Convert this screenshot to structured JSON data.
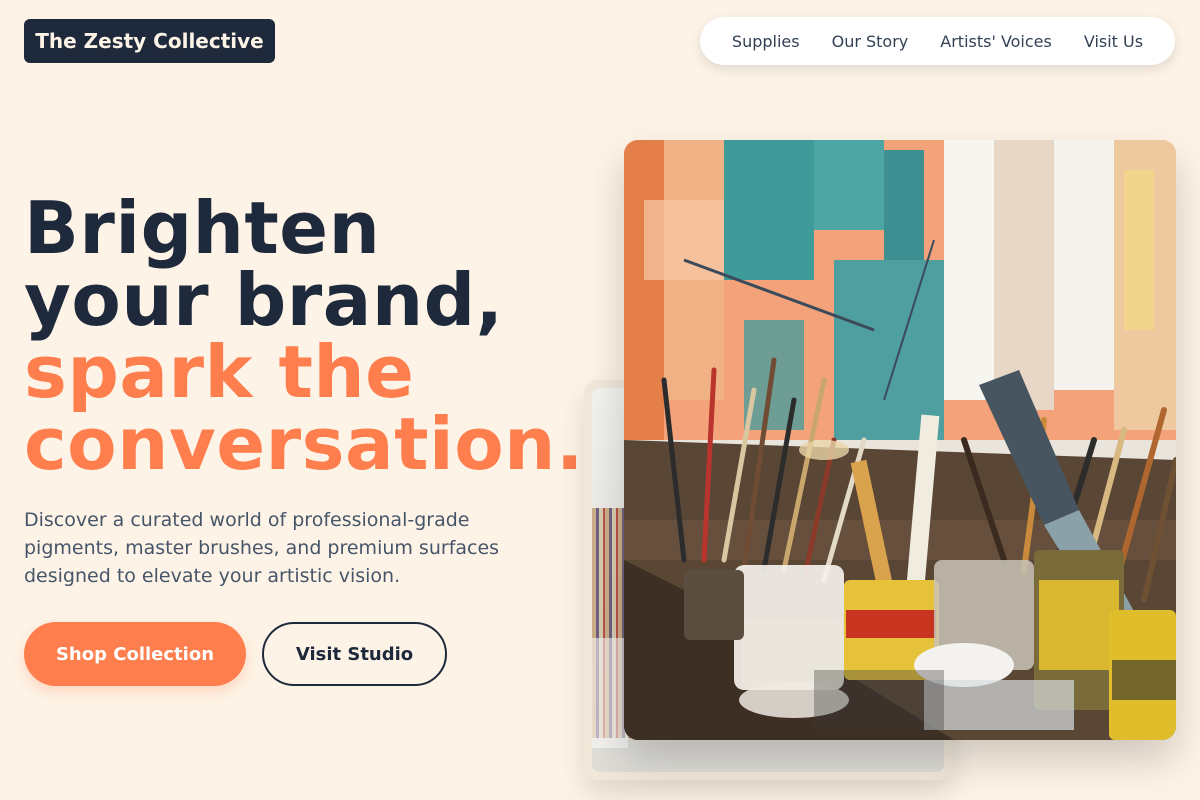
{
  "header": {
    "logo": "The Zesty Collective",
    "nav": [
      "Supplies",
      "Our Story",
      "Artists' Voices",
      "Visit Us"
    ]
  },
  "hero": {
    "headline_dark": [
      "Brighten",
      "your brand,"
    ],
    "headline_accent": [
      "spark the",
      "conversation."
    ],
    "subtitle": "Discover a curated world of professional-grade pigments, master brushes, and premium surfaces designed to elevate your artistic vision.",
    "primary_cta": "Shop Collection",
    "secondary_cta": "Visit Studio"
  },
  "colors": {
    "background": "#fdf4e7",
    "navy": "#1e293b",
    "accent": "#fe7e4e",
    "muted_text": "#475569"
  },
  "images": {
    "main": "artist-studio-photo",
    "back": "paint-brushes-photo"
  }
}
